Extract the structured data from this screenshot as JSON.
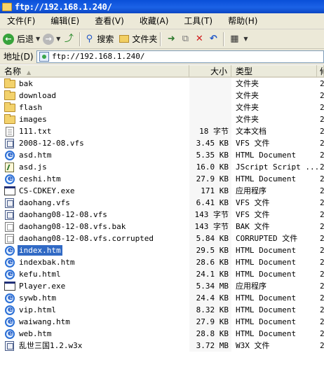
{
  "window": {
    "title": "ftp://192.168.1.240/"
  },
  "menu": [
    "文件(F)",
    "编辑(E)",
    "查看(V)",
    "收藏(A)",
    "工具(T)",
    "帮助(H)"
  ],
  "toolbar": {
    "back_label": "后退",
    "search_label": "搜索",
    "folders_label": "文件夹"
  },
  "address": {
    "label": "地址(D)",
    "value": "ftp://192.168.1.240/"
  },
  "columns": {
    "name": "名称",
    "size": "大小",
    "type": "类型",
    "more": "修"
  },
  "files": [
    {
      "name": "bak",
      "size": "",
      "type": "文件夹",
      "icon": "folder-icon",
      "more": "2"
    },
    {
      "name": "download",
      "size": "",
      "type": "文件夹",
      "icon": "folder-icon",
      "more": "2"
    },
    {
      "name": "flash",
      "size": "",
      "type": "文件夹",
      "icon": "folder-icon",
      "more": "2"
    },
    {
      "name": "images",
      "size": "",
      "type": "文件夹",
      "icon": "folder-icon",
      "more": "2"
    },
    {
      "name": "111.txt",
      "size": "18 字节",
      "type": "文本文档",
      "icon": "text-file-icon",
      "more": "2"
    },
    {
      "name": "2008-12-08.vfs",
      "size": "3.45 KB",
      "type": "VFS 文件",
      "icon": "vfs-file-icon",
      "more": "2"
    },
    {
      "name": "asd.htm",
      "size": "5.35 KB",
      "type": "HTML Document",
      "icon": "html-file-icon",
      "more": "2"
    },
    {
      "name": "asd.js",
      "size": "16.0 KB",
      "type": "JScript Script ...",
      "icon": "jscript-file-icon",
      "more": "2"
    },
    {
      "name": "ceshi.htm",
      "size": "27.9 KB",
      "type": "HTML Document",
      "icon": "html-file-icon",
      "more": "2"
    },
    {
      "name": "CS-CDKEY.exe",
      "size": "171 KB",
      "type": "应用程序",
      "icon": "exe-file-icon",
      "more": "2"
    },
    {
      "name": "daohang.vfs",
      "size": "6.41 KB",
      "type": "VFS 文件",
      "icon": "vfs-file-icon",
      "more": "2"
    },
    {
      "name": "daohang08-12-08.vfs",
      "size": "143 字节",
      "type": "VFS 文件",
      "icon": "vfs-file-icon",
      "more": "2"
    },
    {
      "name": "daohang08-12-08.vfs.bak",
      "size": "143 字节",
      "type": "BAK 文件",
      "icon": "generic-file-icon",
      "more": "2"
    },
    {
      "name": "daohang08-12-08.vfs.corrupted",
      "size": "5.84 KB",
      "type": "CORRUPTED 文件",
      "icon": "generic-file-icon",
      "more": "2"
    },
    {
      "name": "index.htm",
      "size": "29.5 KB",
      "type": "HTML Document",
      "icon": "html-file-icon",
      "more": "2",
      "selected": true
    },
    {
      "name": "indexbak.htm",
      "size": "28.6 KB",
      "type": "HTML Document",
      "icon": "html-file-icon",
      "more": "2"
    },
    {
      "name": "kefu.html",
      "size": "24.1 KB",
      "type": "HTML Document",
      "icon": "html-file-icon",
      "more": "2"
    },
    {
      "name": "Player.exe",
      "size": "5.34 MB",
      "type": "应用程序",
      "icon": "exe-file-icon",
      "more": "2"
    },
    {
      "name": "sywb.htm",
      "size": "24.4 KB",
      "type": "HTML Document",
      "icon": "html-file-icon",
      "more": "2"
    },
    {
      "name": "vip.html",
      "size": "8.32 KB",
      "type": "HTML Document",
      "icon": "html-file-icon",
      "more": "2"
    },
    {
      "name": "waiwang.htm",
      "size": "27.9 KB",
      "type": "HTML Document",
      "icon": "html-file-icon",
      "more": "2"
    },
    {
      "name": "web.htm",
      "size": "28.8 KB",
      "type": "HTML Document",
      "icon": "html-file-icon",
      "more": "2"
    },
    {
      "name": "乱世三国1.2.w3x",
      "size": "3.72 MB",
      "type": "W3X 文件",
      "icon": "w3x-file-icon",
      "more": "2"
    }
  ],
  "colors": {
    "titlebar": "#0a4fd8",
    "chrome": "#ece9d8",
    "selection": "#316ac5"
  }
}
